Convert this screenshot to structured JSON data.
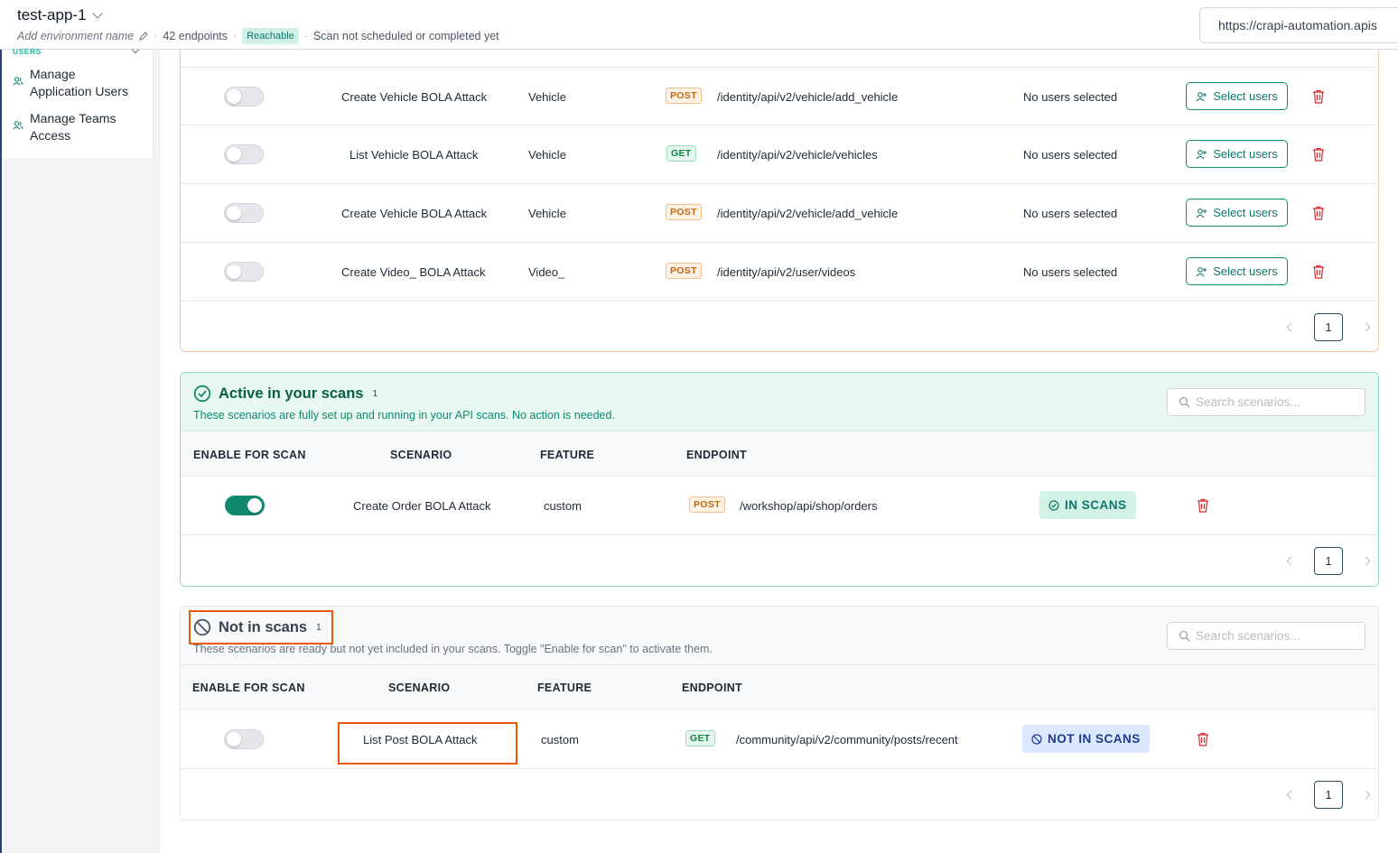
{
  "header": {
    "app_name": "test-app-1",
    "env_placeholder": "Add environment name",
    "endpoints": "42 endpoints",
    "reachable": "Reachable",
    "scan_status": "Scan not scheduled or completed yet",
    "url": "https://crapi-automation.apis"
  },
  "sidebar": {
    "section": "USERS",
    "items": [
      {
        "label": "Manage Application Users"
      },
      {
        "label": "Manage Teams Access"
      }
    ]
  },
  "config_rows": [
    {
      "scenario": "Create Vehicle BOLA Attack",
      "feature": "Vehicle",
      "method": "POST",
      "endpoint": "/identity/api/v2/vehicle/add_vehicle",
      "users": "No users selected",
      "action": "Select users"
    },
    {
      "scenario": "List Vehicle BOLA Attack",
      "feature": "Vehicle",
      "method": "GET",
      "endpoint": "/identity/api/v2/vehicle/vehicles",
      "users": "No users selected",
      "action": "Select users"
    },
    {
      "scenario": "Create Vehicle BOLA Attack",
      "feature": "Vehicle",
      "method": "POST",
      "endpoint": "/identity/api/v2/vehicle/add_vehicle",
      "users": "No users selected",
      "action": "Select users"
    },
    {
      "scenario": "Create Video_ BOLA Attack",
      "feature": "Video_",
      "method": "POST",
      "endpoint": "/identity/api/v2/user/videos",
      "users": "No users selected",
      "action": "Select users"
    }
  ],
  "config_pager": {
    "page": "1"
  },
  "active": {
    "title": "Active in your scans",
    "count": "1",
    "description": "These scenarios are fully set up and running in your API scans. No action is needed.",
    "search_placeholder": "Search scenarios...",
    "columns": [
      "ENABLE FOR SCAN",
      "SCENARIO",
      "FEATURE",
      "ENDPOINT"
    ],
    "row": {
      "scenario": "Create Order BOLA Attack",
      "feature": "custom",
      "method": "POST",
      "endpoint": "/workshop/api/shop/orders",
      "status": "IN SCANS",
      "enabled": true
    },
    "page": "1"
  },
  "not_in_scans": {
    "title": "Not in scans",
    "count": "1",
    "description": "These scenarios are ready but not yet included in your scans. Toggle \"Enable for scan\" to activate them.",
    "search_placeholder": "Search scenarios...",
    "columns": [
      "ENABLE FOR SCAN",
      "SCENARIO",
      "FEATURE",
      "ENDPOINT"
    ],
    "row": {
      "scenario": "List Post BOLA Attack",
      "feature": "custom",
      "method": "GET",
      "endpoint": "/community/api/v2/community/posts/recent",
      "status": "NOT IN SCANS",
      "enabled": false
    },
    "page": "1"
  },
  "colors": {
    "accent": "#0f8a6f",
    "highlight": "#ea580c",
    "post": "#c2690f",
    "get": "#15803d"
  }
}
